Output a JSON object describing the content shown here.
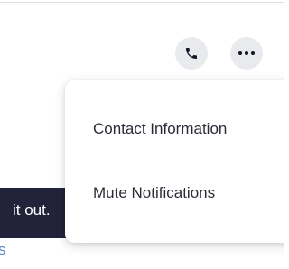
{
  "header": {
    "call_icon": "phone-icon",
    "more_icon": "more-horizontal-icon"
  },
  "menu": {
    "items": [
      {
        "label": "Contact Information"
      },
      {
        "label": "Mute Notifications"
      }
    ]
  },
  "banner": {
    "text": "it out."
  },
  "partial_text": "s",
  "colors": {
    "icon_bg": "#e9eaee",
    "banner_bg": "#23223b",
    "link": "#5b88c7"
  }
}
